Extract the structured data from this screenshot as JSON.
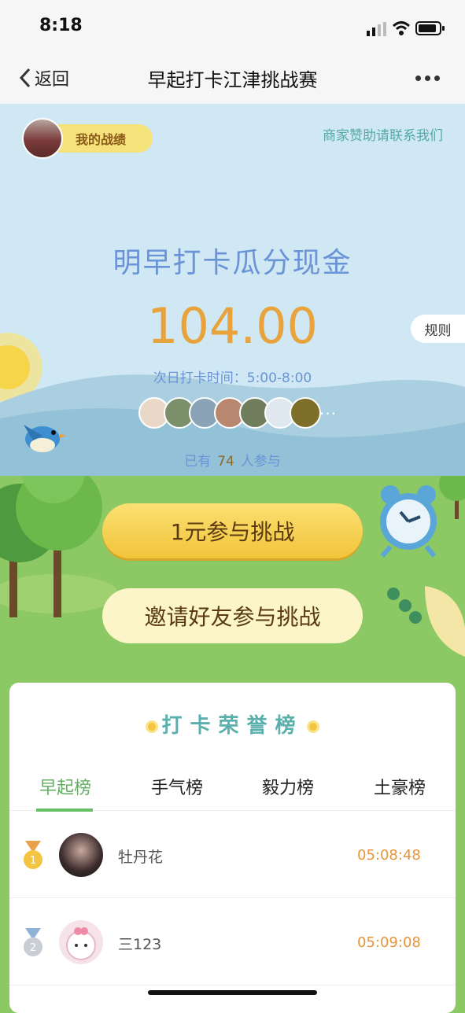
{
  "status_bar": {
    "time": "8:18"
  },
  "nav": {
    "back_label": "返回",
    "title": "早起打卡江津挑战赛"
  },
  "header": {
    "my_record": "我的战绩",
    "sponsor_link": "商家赞助请联系我们"
  },
  "hero": {
    "headline": "明早打卡瓜分现金",
    "amount": "104.00",
    "rule": "规则",
    "checkin_time": "次日打卡时间：5:00-8:00",
    "participants_more": "···",
    "joined_prefix": "已有",
    "joined_count": "74",
    "joined_suffix": "人参与"
  },
  "buttons": {
    "join": "1元参与挑战",
    "invite": "邀请好友参与挑战"
  },
  "leaderboard": {
    "title": "打卡荣誉榜",
    "tabs": [
      {
        "label": "早起榜"
      },
      {
        "label": "手气榜"
      },
      {
        "label": "毅力榜"
      },
      {
        "label": "土豪榜"
      }
    ],
    "rows": [
      {
        "rank": "1",
        "name": "牡丹花",
        "time": "05:08:48"
      },
      {
        "rank": "2",
        "name": "三123",
        "time": "05:09:08"
      }
    ]
  },
  "colors": {
    "accent_green": "#66ad66",
    "amount_orange": "#e8a33c",
    "title_teal": "#5ab0ad",
    "button_yellow": "#f2c43a"
  }
}
